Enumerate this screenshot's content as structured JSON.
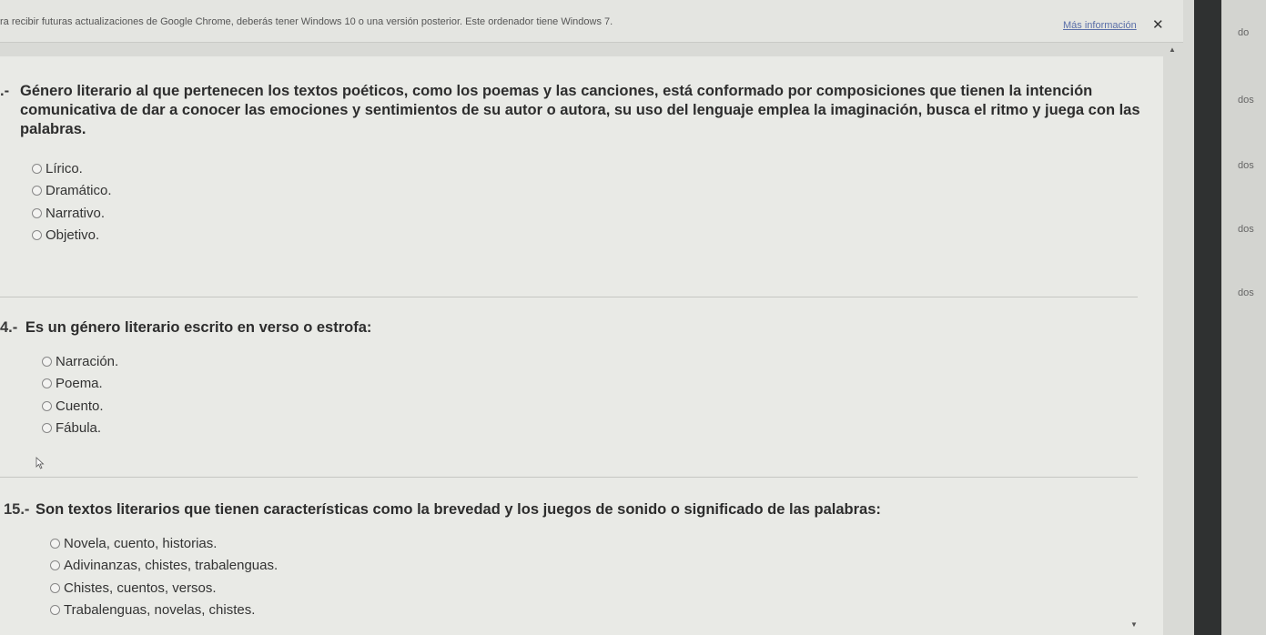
{
  "infobar": {
    "message": "ra recibir futuras actualizaciones de Google Chrome, deberás tener Windows 10 o una versión posterior. Este ordenador tiene Windows 7.",
    "link": "Más información",
    "close": "✕"
  },
  "side_labels": [
    "do",
    "dos",
    "dos",
    "dos",
    "dos"
  ],
  "questions": [
    {
      "number": ".-",
      "text": "Género literario al que pertenecen los textos poéticos, como los poemas y las canciones, está conformado por composiciones que tienen la intención comunicativa de dar a conocer las emociones y sentimientos de su autor o autora, su uso del lenguaje emplea la imaginación, busca el ritmo y juega con las palabras.",
      "options": [
        "Lírico.",
        "Dramático.",
        "Narrativo.",
        "Objetivo."
      ]
    },
    {
      "number": "4.-",
      "text": "Es un género literario escrito en verso o estrofa:",
      "options": [
        "Narración.",
        "Poema.",
        "Cuento.",
        "Fábula."
      ]
    },
    {
      "number": "15.-",
      "text": "Son textos literarios que tienen características como la brevedad y los juegos de sonido o significado de las palabras:",
      "options": [
        "Novela, cuento, historias.",
        "Adivinanzas, chistes, trabalenguas.",
        "Chistes, cuentos, versos.",
        "Trabalenguas, novelas, chistes."
      ]
    }
  ]
}
